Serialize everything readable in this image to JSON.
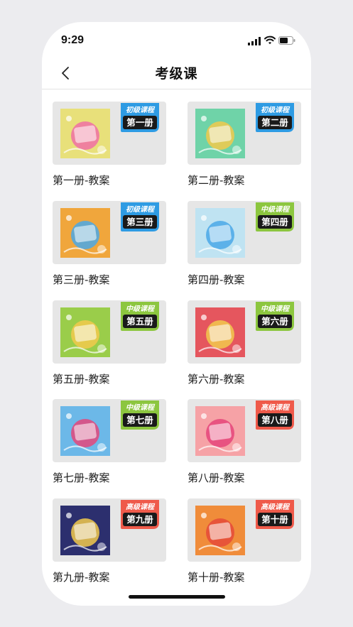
{
  "status_bar": {
    "time": "9:29"
  },
  "nav": {
    "title": "考级课"
  },
  "courses": [
    {
      "label": "第一册-教案",
      "level": "初级课程",
      "book": "第一册",
      "tag_color": "#2e9be3",
      "cover_bg": "#e8e07a",
      "cover_accent": "#f06fa6"
    },
    {
      "label": "第二册-教案",
      "level": "初级课程",
      "book": "第二册",
      "tag_color": "#2e9be3",
      "cover_bg": "#6fd3a8",
      "cover_accent": "#f2c94c"
    },
    {
      "label": "第三册-教案",
      "level": "初级课程",
      "book": "第三册",
      "tag_color": "#2e9be3",
      "cover_bg": "#f0a63c",
      "cover_accent": "#4aa8e8"
    },
    {
      "label": "第四册-教案",
      "level": "中级课程",
      "book": "第四册",
      "tag_color": "#8cc63f",
      "cover_bg": "#bfe3f2",
      "cover_accent": "#4aa8e8"
    },
    {
      "label": "第五册-教案",
      "level": "中级课程",
      "book": "第五册",
      "tag_color": "#8cc63f",
      "cover_bg": "#9acd4a",
      "cover_accent": "#f2c94c"
    },
    {
      "label": "第六册-教案",
      "level": "中级课程",
      "book": "第六册",
      "tag_color": "#8cc63f",
      "cover_bg": "#e5565e",
      "cover_accent": "#f2c94c"
    },
    {
      "label": "第七册-教案",
      "level": "中级课程",
      "book": "第七册",
      "tag_color": "#8cc63f",
      "cover_bg": "#6cb8e8",
      "cover_accent": "#e5457a"
    },
    {
      "label": "第八册-教案",
      "level": "高级课程",
      "book": "第八册",
      "tag_color": "#ef5a4a",
      "cover_bg": "#f6a2a6",
      "cover_accent": "#e5457a"
    },
    {
      "label": "第九册-教案",
      "level": "高级课程",
      "book": "第九册",
      "tag_color": "#ef5a4a",
      "cover_bg": "#2c2f6e",
      "cover_accent": "#f2c94c"
    },
    {
      "label": "第十册-教案",
      "level": "高级课程",
      "book": "第十册",
      "tag_color": "#ef5a4a",
      "cover_bg": "#f08c3a",
      "cover_accent": "#e54a3a"
    }
  ]
}
